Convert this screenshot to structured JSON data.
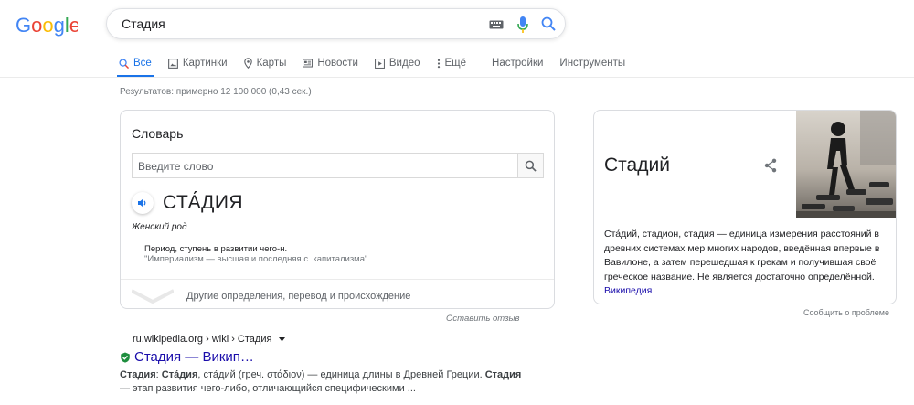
{
  "logo": {
    "text": "Google"
  },
  "search": {
    "query": "Стадия"
  },
  "tabs": [
    {
      "label": "Все"
    },
    {
      "label": "Картинки"
    },
    {
      "label": "Карты"
    },
    {
      "label": "Новости"
    },
    {
      "label": "Видео"
    },
    {
      "label": "Ещё"
    },
    {
      "label": "Настройки"
    },
    {
      "label": "Инструменты"
    }
  ],
  "stats": "Результатов: примерно 12 100 000 (0,43 сек.)",
  "dictionary": {
    "title": "Словарь",
    "placeholder": "Введите слово",
    "word": "СТА́ДИЯ",
    "gender": "Женский род",
    "definition": "Период, ступень в развитии чего-н.",
    "example": "\"Империализм — высшая и последняя с. капитализма\"",
    "more": "Другие определения, перевод и происхождение",
    "feedback": "Оставить отзыв"
  },
  "result": {
    "breadcrumb": "ru.wikipedia.org › wiki › Стадия",
    "title": "Стадия — Викип…",
    "snippet_lead": "Стадия",
    "snippet_sep": ": ",
    "snippet_bold2": "Ста́дия",
    "snippet_mid": ", ста́дий (греч. στάδιον) — единица длины в Древней Греции. ",
    "snippet_bold3": "Стадия",
    "snippet_tail": " — этап развития чего-либо, отличающийся специфическими ..."
  },
  "knowledge_panel": {
    "title": "Стадий",
    "description": "Ста́дий, стадион, стадия — единица измерения расстояний в древних системах мер многих народов, введённая впервые в Вавилоне, а затем перешедшая к грекам и получившая своё греческое название. Не является достаточно определённой.",
    "link": "Википедия",
    "report": "Сообщить о проблеме"
  },
  "colors": {
    "accent": "#1a73e8",
    "link": "#1a0dab",
    "muted": "#70757a"
  }
}
